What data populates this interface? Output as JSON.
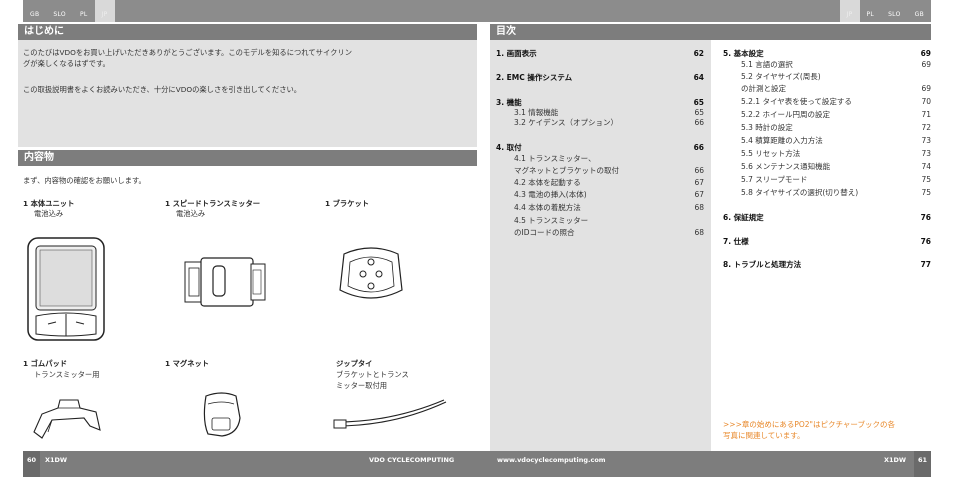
{
  "tabs_left": [
    "GB",
    "SLO",
    "PL",
    "JP"
  ],
  "tabs_right": [
    "JP",
    "PL",
    "SLO",
    "GB"
  ],
  "intro": {
    "header": "はじめに",
    "p1": "このたびはVDOをお買い上げいただきありがとうございます。このモデルを知るにつれてサイクリン",
    "p1b": "グが楽しくなるはずです。",
    "p2": "この取扱説明書をよくお読みいただき、十分にVDOの楽しさを引き出してください。"
  },
  "contents": {
    "header": "内容物",
    "intro": "まず、内容物の確認をお願いします。",
    "items": [
      {
        "title": "1  本体ユニット",
        "sub": "電池込み"
      },
      {
        "title": "1  スピードトランスミッター",
        "sub": "電池込み"
      },
      {
        "title": "1  ブラケット",
        "sub": ""
      },
      {
        "title": "1  ゴムパッド",
        "sub": "トランスミッター用"
      },
      {
        "title": "1  マグネット",
        "sub": ""
      },
      {
        "title": "ジップタイ",
        "sub": "ブラケットとトランス",
        "sub2": "ミッター取付用"
      }
    ]
  },
  "toc": {
    "header": "目次",
    "col1": [
      {
        "label": "1.   画面表示",
        "page": "62",
        "main": true
      },
      {
        "label": "2.   EMC 操作システム",
        "page": "64",
        "main": true
      },
      {
        "label": "3.   機能",
        "page": "65",
        "main": true
      },
      {
        "label": "3.1      情報機能",
        "page": "65",
        "main": false
      },
      {
        "label": "3.2      ケイデンス（オプション）",
        "page": "66",
        "main": false
      },
      {
        "label": "4.   取付",
        "page": "66",
        "main": true
      },
      {
        "label": "4.1      トランスミッター、",
        "page": "",
        "main": false
      },
      {
        "label": "            マグネットとブラケットの取付",
        "page": "66",
        "main": false
      },
      {
        "label": "4.2      本体を起動する",
        "page": "67",
        "main": false
      },
      {
        "label": "4.3      電池の挿入(本体)",
        "page": "67",
        "main": false
      },
      {
        "label": "4.4      本体の着脱方法",
        "page": "68",
        "main": false
      },
      {
        "label": "4.5      トランスミッター",
        "page": "",
        "main": false
      },
      {
        "label": "            のIDコードの照合",
        "page": "68",
        "main": false
      }
    ],
    "col2": [
      {
        "label": "5.   基本設定",
        "page": "69",
        "main": true
      },
      {
        "label": "5.1      言語の選択",
        "page": "69",
        "main": false
      },
      {
        "label": "5.2      タイヤサイズ(周長)",
        "page": "",
        "main": false
      },
      {
        "label": "            の計測と設定",
        "page": "69",
        "main": false
      },
      {
        "label": "5.2.1  タイヤ表を使って設定する",
        "page": "70",
        "main": false
      },
      {
        "label": "5.2.2  ホイール円周の設定",
        "page": "71",
        "main": false
      },
      {
        "label": "5.3      時計の設定",
        "page": "72",
        "main": false
      },
      {
        "label": "5.4      積算距離の入力方法",
        "page": "73",
        "main": false
      },
      {
        "label": "5.5      リセット方法",
        "page": "73",
        "main": false
      },
      {
        "label": "5.6      メンテナンス通知機能",
        "page": "74",
        "main": false
      },
      {
        "label": "5.7      スリープモード",
        "page": "75",
        "main": false
      },
      {
        "label": "5.8      タイヤサイズの選択(切り替え)",
        "page": "75",
        "main": false
      },
      {
        "label": "6.   保証規定",
        "page": "76",
        "main": true
      },
      {
        "label": "7.   仕様",
        "page": "76",
        "main": true
      },
      {
        "label": "8.   トラブルと処理方法",
        "page": "77",
        "main": true
      }
    ],
    "note1": ">>>章の始めにあるPO2\"はピクチャーブックの各",
    "note2": "写真に関連しています。"
  },
  "footer": {
    "page_left": "60",
    "model_left": "X1DW",
    "brand": "VDO CYCLECOMPUTING",
    "url": "www.vdocyclecomputing.com",
    "model_right": "X1DW",
    "page_right": "61"
  },
  "colors": {
    "header_gray": "#7d7d7d",
    "box_gray": "#e2e2e2",
    "note_orange": "#e8882a"
  }
}
